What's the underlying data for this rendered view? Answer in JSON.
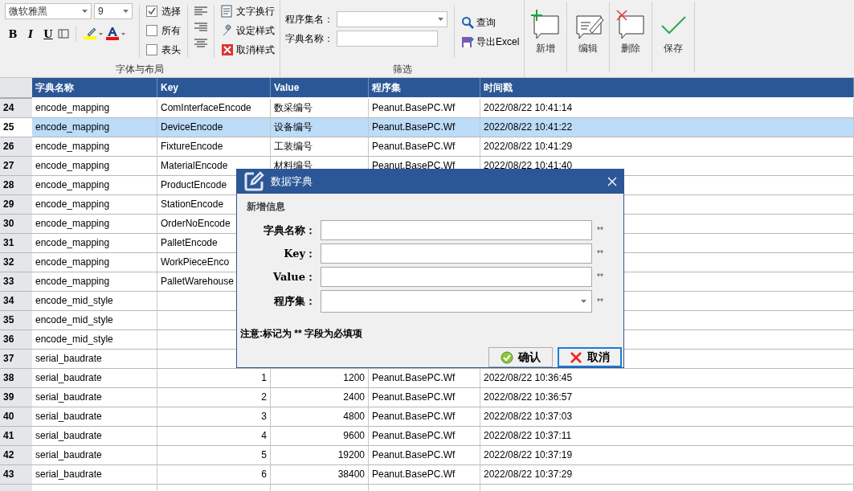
{
  "ribbon": {
    "font_group": {
      "font_name": "微软雅黑",
      "font_size": "9",
      "format_buttons": [
        {
          "label": "B",
          "kind": "bold"
        },
        {
          "label": "I",
          "kind": "italic"
        },
        {
          "label": "U",
          "kind": "underline"
        }
      ],
      "checkboxes": [
        {
          "label": "选择",
          "checked": true
        },
        {
          "label": "所有",
          "checked": false
        },
        {
          "label": "表头",
          "checked": false
        }
      ],
      "actions": [
        {
          "label": "文字换行",
          "kind": "wrap"
        },
        {
          "label": "设定样式",
          "kind": "style"
        },
        {
          "label": "取消样式",
          "kind": "clear"
        }
      ],
      "title": "字体与布局"
    },
    "filter_group": {
      "fields": [
        {
          "label": "程序集名：",
          "kind": "dropdown"
        },
        {
          "label": "字典名称：",
          "kind": "text"
        }
      ],
      "actions": [
        {
          "label": "查询",
          "kind": "search"
        },
        {
          "label": "导出Excel",
          "kind": "export"
        }
      ],
      "title": "筛选"
    },
    "big_buttons": [
      {
        "label": "新增",
        "kind": "add"
      },
      {
        "label": "编辑",
        "kind": "edit"
      },
      {
        "label": "删除",
        "kind": "delete"
      },
      {
        "label": "保存",
        "kind": "save"
      }
    ]
  },
  "table": {
    "columns": [
      "字典名称",
      "Key",
      "Value",
      "程序集",
      "时间戳"
    ],
    "rows": [
      {
        "number": "24",
        "selected": false,
        "kind": "text",
        "cells": [
          "encode_mapping",
          "ComInterfaceEncode",
          "数采编号",
          "Peanut.BasePC.Wf",
          "2022/08/22 10:41:14"
        ]
      },
      {
        "number": "25",
        "selected": true,
        "kind": "text",
        "cells": [
          "encode_mapping",
          "DeviceEncode",
          "设备编号",
          "Peanut.BasePC.Wf",
          "2022/08/22 10:41:22"
        ]
      },
      {
        "number": "26",
        "selected": false,
        "kind": "text",
        "cells": [
          "encode_mapping",
          "FixtureEncode",
          "工装编号",
          "Peanut.BasePC.Wf",
          "2022/08/22 10:41:29"
        ]
      },
      {
        "number": "27",
        "selected": false,
        "kind": "text",
        "cells": [
          "encode_mapping",
          "MaterialEncode",
          "材料编号",
          "Peanut.BasePC.Wf",
          "2022/08/22 10:41:40"
        ]
      },
      {
        "number": "28",
        "selected": false,
        "kind": "text",
        "cells": [
          "encode_mapping",
          "ProductEncode"
        ]
      },
      {
        "number": "29",
        "selected": false,
        "kind": "text",
        "cells": [
          "encode_mapping",
          "StationEncode"
        ]
      },
      {
        "number": "30",
        "selected": false,
        "kind": "text",
        "cells": [
          "encode_mapping",
          "OrderNoEncode"
        ]
      },
      {
        "number": "31",
        "selected": false,
        "kind": "text",
        "cells": [
          "encode_mapping",
          "PalletEncode"
        ]
      },
      {
        "number": "32",
        "selected": false,
        "kind": "text",
        "cells": [
          "encode_mapping",
          "WorkPieceEnco"
        ]
      },
      {
        "number": "33",
        "selected": false,
        "kind": "text",
        "cells": [
          "encode_mapping",
          "PalletWarehouse"
        ]
      },
      {
        "number": "34",
        "selected": false,
        "kind": "text",
        "cells": [
          "encode_mid_style"
        ]
      },
      {
        "number": "35",
        "selected": false,
        "kind": "text",
        "cells": [
          "encode_mid_style"
        ]
      },
      {
        "number": "36",
        "selected": false,
        "kind": "text",
        "cells": [
          "encode_mid_style"
        ]
      },
      {
        "number": "37",
        "selected": false,
        "kind": "text",
        "cells": [
          "serial_baudrate"
        ]
      },
      {
        "number": "38",
        "selected": false,
        "kind": "numeric",
        "cells": [
          "serial_baudrate",
          "1",
          "1200",
          "Peanut.BasePC.Wf",
          "2022/08/22 10:36:45"
        ]
      },
      {
        "number": "39",
        "selected": false,
        "kind": "numeric",
        "cells": [
          "serial_baudrate",
          "2",
          "2400",
          "Peanut.BasePC.Wf",
          "2022/08/22 10:36:57"
        ]
      },
      {
        "number": "40",
        "selected": false,
        "kind": "numeric",
        "cells": [
          "serial_baudrate",
          "3",
          "4800",
          "Peanut.BasePC.Wf",
          "2022/08/22 10:37:03"
        ]
      },
      {
        "number": "41",
        "selected": false,
        "kind": "numeric",
        "cells": [
          "serial_baudrate",
          "4",
          "9600",
          "Peanut.BasePC.Wf",
          "2022/08/22 10:37:11"
        ]
      },
      {
        "number": "42",
        "selected": false,
        "kind": "numeric",
        "cells": [
          "serial_baudrate",
          "5",
          "19200",
          "Peanut.BasePC.Wf",
          "2022/08/22 10:37:19"
        ]
      },
      {
        "number": "43",
        "selected": false,
        "kind": "numeric",
        "cells": [
          "serial_baudrate",
          "6",
          "38400",
          "Peanut.BasePC.Wf",
          "2022/08/22 10:37:29"
        ]
      }
    ]
  },
  "dialog": {
    "title": "数据字典",
    "section": "新增信息",
    "fields": [
      {
        "label": "字典名称：",
        "kind": "text",
        "required": "**"
      },
      {
        "label": "Key：",
        "kind": "text",
        "required": "**"
      },
      {
        "label": "Value：",
        "kind": "text",
        "required": "**"
      },
      {
        "label": "程序集：",
        "kind": "dropdown",
        "required": "**"
      }
    ],
    "note": "注意:标记为 ** 字段为必填项",
    "buttons": [
      {
        "label": "确认",
        "kind": "ok",
        "focused": false
      },
      {
        "label": "取消",
        "kind": "cancel",
        "focused": true
      }
    ]
  }
}
